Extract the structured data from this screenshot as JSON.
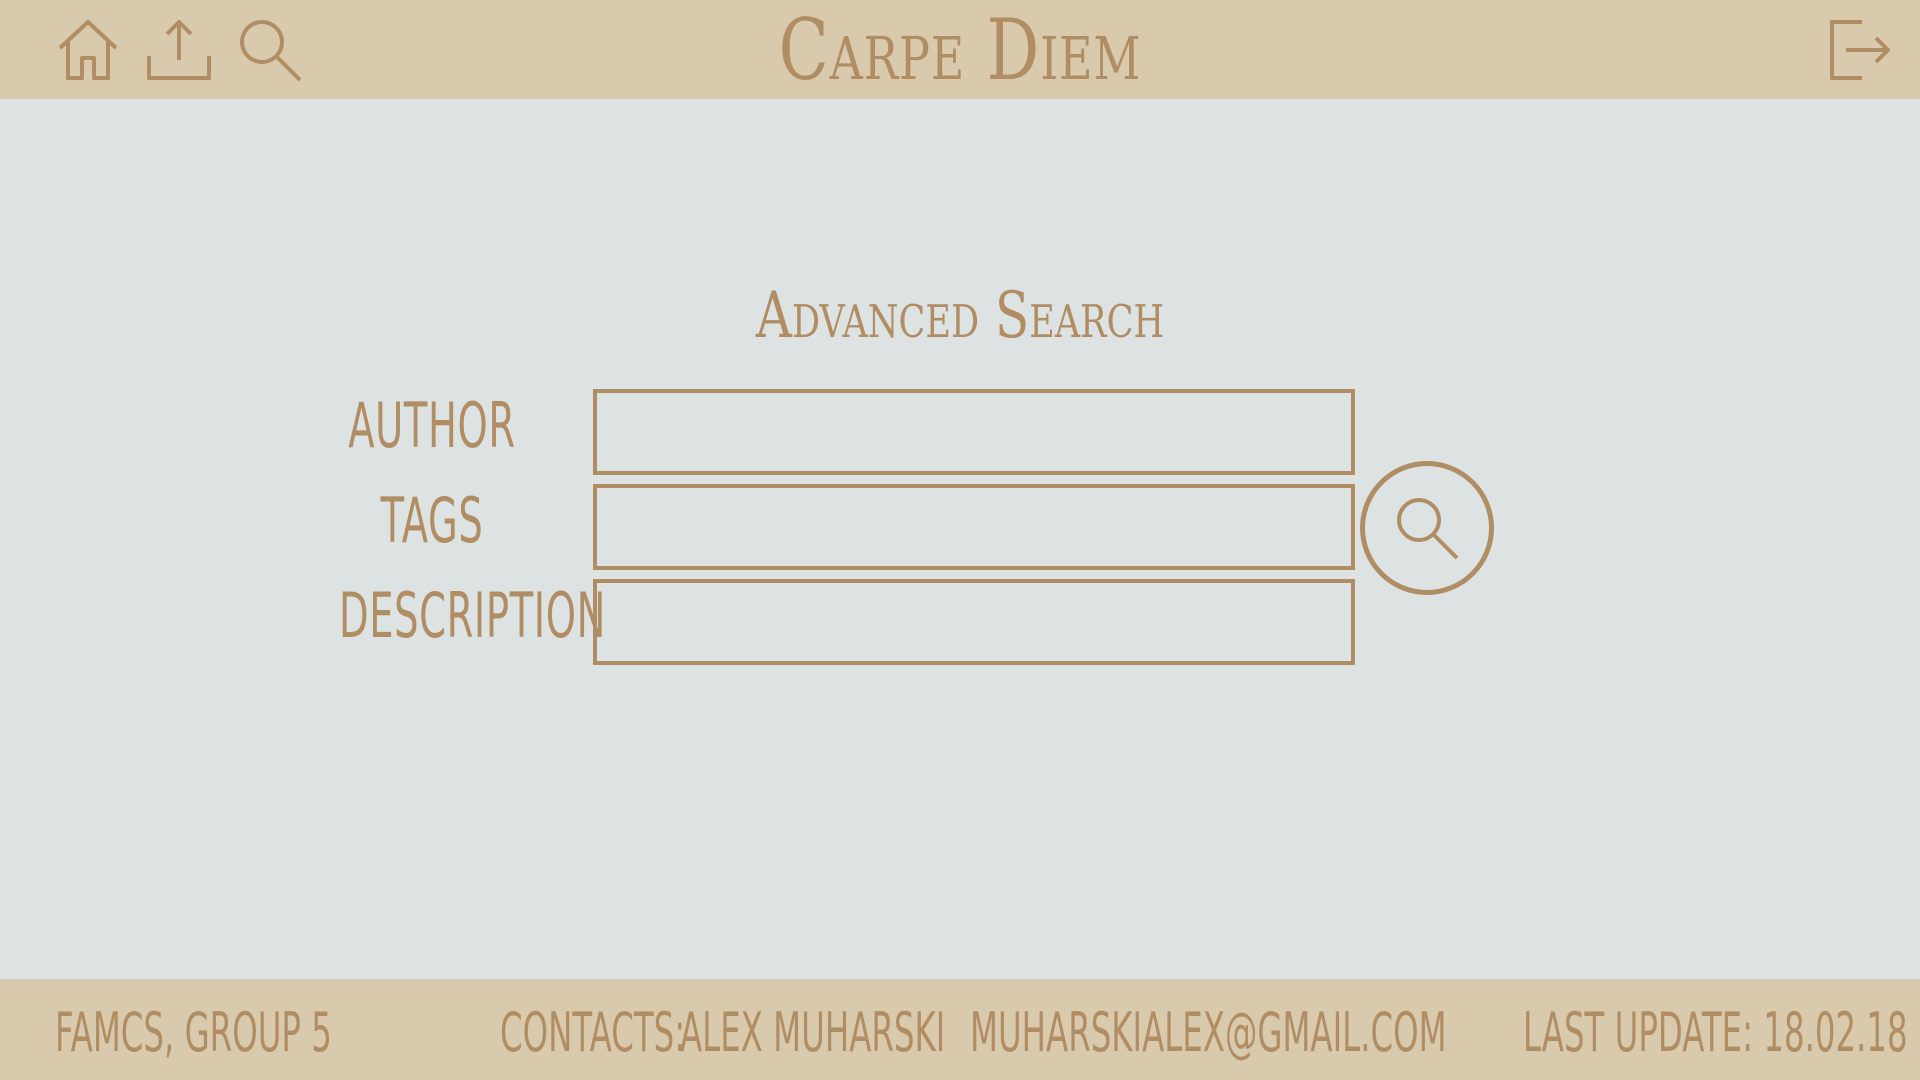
{
  "header": {
    "title": "Carpe Diem",
    "icons": {
      "home": "home-icon",
      "upload": "upload-icon",
      "search": "search-icon",
      "logout": "logout-icon"
    }
  },
  "form": {
    "title": "Advanced Search",
    "fields": {
      "author": {
        "label": "AUTHOR",
        "value": "",
        "placeholder": ""
      },
      "tags": {
        "label": "TAGS",
        "value": "",
        "placeholder": ""
      },
      "description": {
        "label": "DESCRIPTION",
        "value": "",
        "placeholder": ""
      }
    },
    "submit_icon": "search-icon"
  },
  "footer": {
    "group": "famcs, group 5",
    "contacts_label": "contacts:",
    "contact_name": "alex muharski",
    "email": "muharskialex@gmail.com",
    "last_update": "last update: 18.02.18"
  },
  "colors": {
    "accent": "#b08d63",
    "bar_background": "#d9c9ad",
    "page_background": "#dde2e3"
  }
}
